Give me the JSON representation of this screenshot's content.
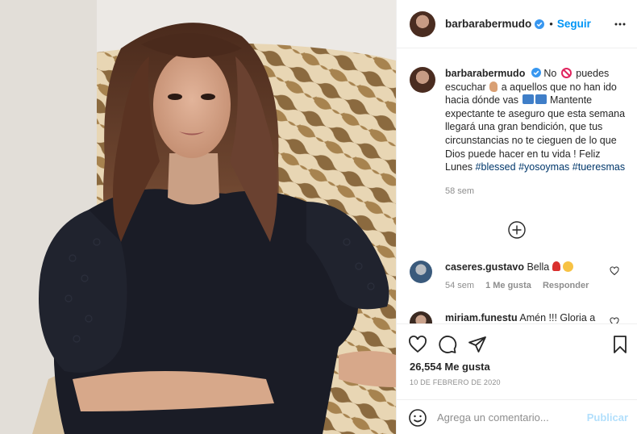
{
  "post": {
    "photo_alt": "barbarabermudo photo",
    "colors": {
      "accent": "#0095f6",
      "hashtag": "#00376b",
      "muted": "#8e8e8e"
    }
  },
  "header": {
    "username": "barbarabermudo",
    "separator": "•",
    "follow_label": "Seguir"
  },
  "caption": {
    "username": "barbarabermudo",
    "text_part1": "No",
    "text_part2": "puedes escuchar",
    "text_part3": "a aquellos que no han ido hacia dónde vas",
    "text_part4": "Mantente expectante te aseguro que esta semana llegará una gran bendición, que tus circunstancias no te cieguen de lo que Dios puede hacer en tu vida ! Feliz Lunes",
    "hashtags": [
      "#blessed",
      "#yosoymas",
      "#tueresmas"
    ],
    "time": "58 sem"
  },
  "comments": [
    {
      "username": "caseres.gustavo",
      "text": "Bella",
      "time": "54 sem",
      "likes": "1 Me gusta",
      "reply": "Responder"
    },
    {
      "username": "miriam.funestu",
      "text": "Amén !!! Gloria a"
    }
  ],
  "actions": {
    "likes_count": "26,554",
    "likes_label": "Me gusta",
    "date": "10 DE FEBRERO DE 2020",
    "comment_placeholder": "Agrega un comentario...",
    "post_label": "Publicar"
  }
}
